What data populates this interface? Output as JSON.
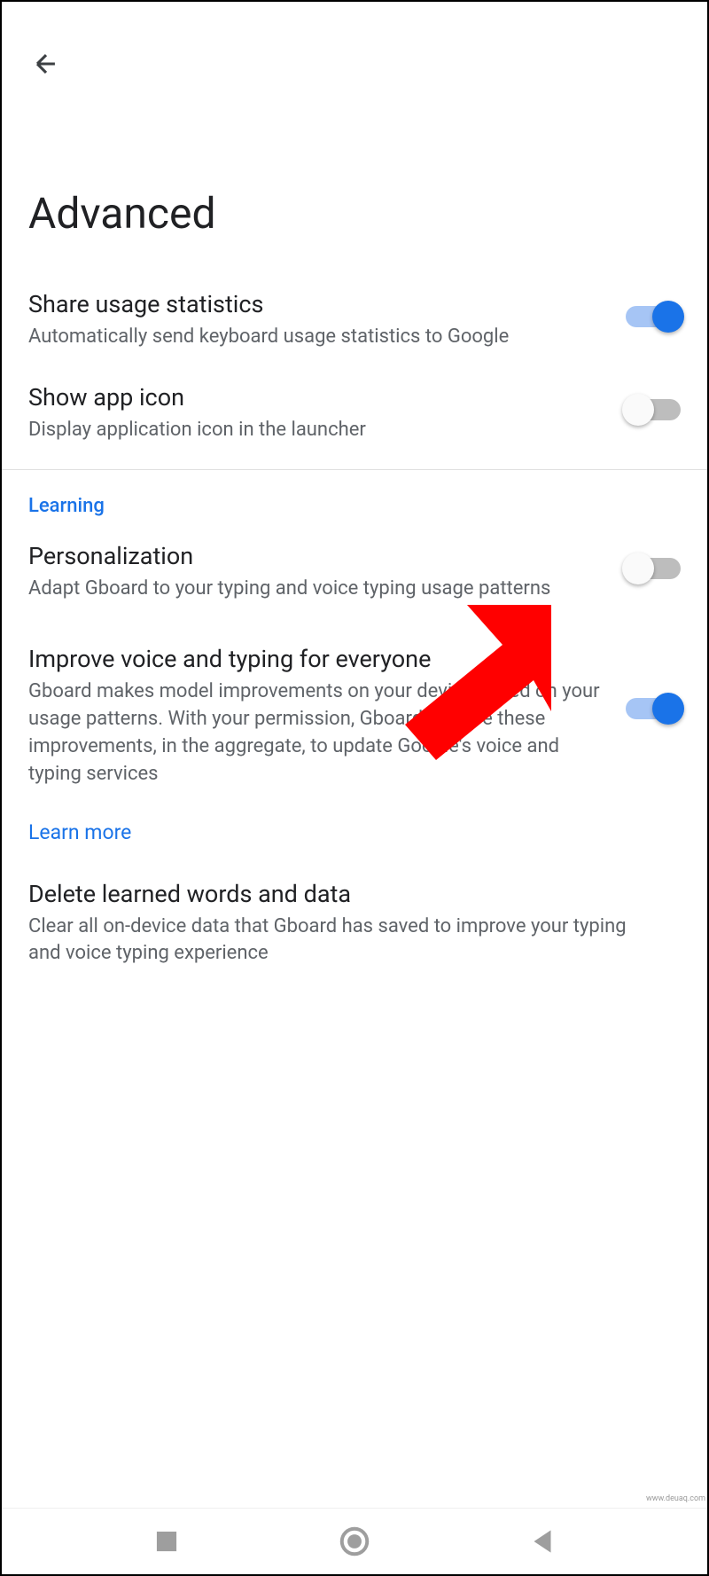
{
  "page": {
    "title": "Advanced"
  },
  "settings": {
    "share_stats": {
      "title": "Share usage statistics",
      "description": "Automatically send keyboard usage statistics to Google",
      "enabled": true
    },
    "show_app_icon": {
      "title": "Show app icon",
      "description": "Display application icon in the launcher",
      "enabled": false
    }
  },
  "section": {
    "learning": "Learning"
  },
  "learning_settings": {
    "personalization": {
      "title": "Personalization",
      "description": "Adapt Gboard to your typing and voice typing usage patterns",
      "enabled": false
    },
    "improve_voice": {
      "title": "Improve voice and typing for everyone",
      "description": "Gboard makes model improvements on your device based on your usage patterns. With your permission, Gboard will use these improvements, in the aggregate, to update Google's voice and typing services",
      "enabled": true,
      "learn_more": "Learn more"
    },
    "delete_learned": {
      "title": "Delete learned words and data",
      "description": "Clear all on-device data that Gboard has saved to improve your typing and voice typing experience"
    }
  },
  "watermark": "www.deuaq.com"
}
